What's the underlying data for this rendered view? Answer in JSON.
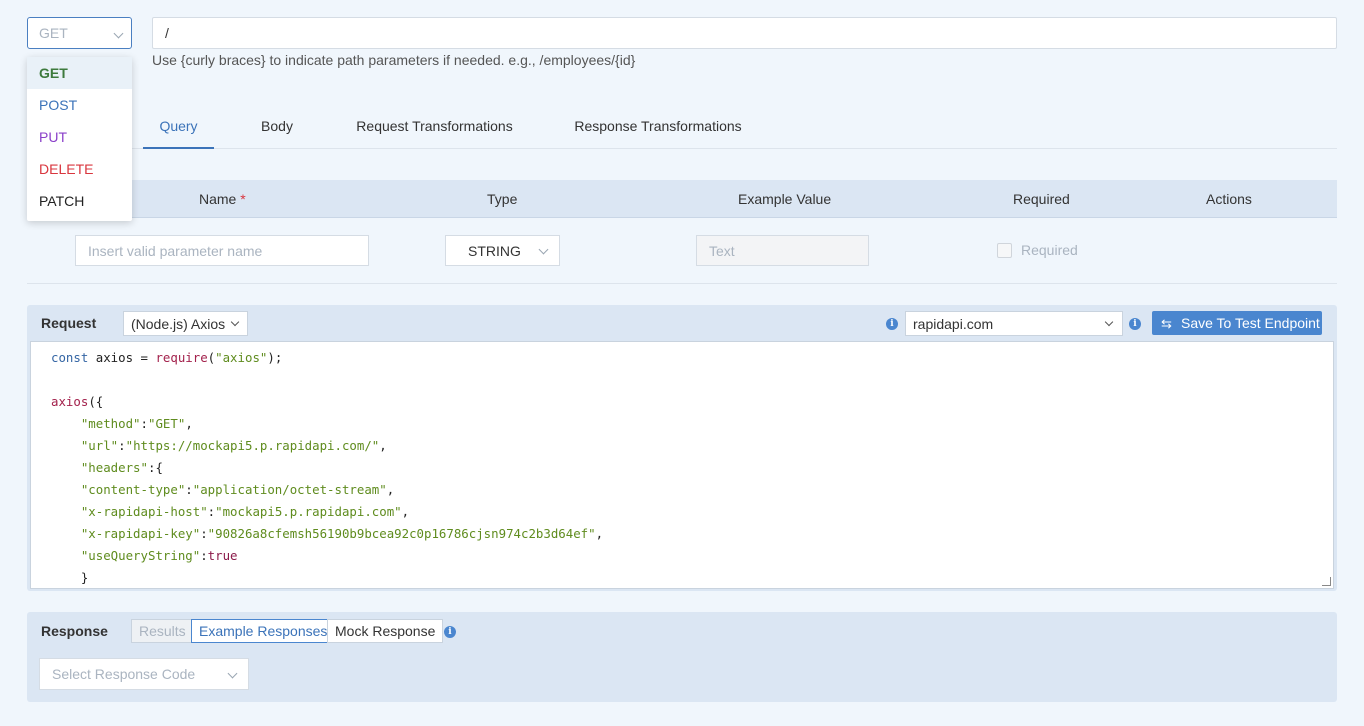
{
  "method": {
    "selected": "GET",
    "options": [
      {
        "label": "GET",
        "color": "#3d7a3d"
      },
      {
        "label": "POST",
        "color": "#3b73b9"
      },
      {
        "label": "PUT",
        "color": "#8a3fc9"
      },
      {
        "label": "DELETE",
        "color": "#d9363e"
      },
      {
        "label": "PATCH",
        "color": "#222222"
      }
    ]
  },
  "path": {
    "value": "/",
    "hint": "Use {curly braces} to indicate path parameters if needed. e.g., /employees/{id}"
  },
  "tabs": [
    "Query",
    "Body",
    "Request Transformations",
    "Response Transformations"
  ],
  "active_tab": "Query",
  "params": {
    "headers": {
      "name": "Name",
      "required_mark": "*",
      "type": "Type",
      "example": "Example Value",
      "required": "Required",
      "actions": "Actions"
    },
    "row": {
      "name_placeholder": "Insert valid parameter name",
      "type": "STRING",
      "example_placeholder": "Text",
      "required_label": "Required"
    }
  },
  "request": {
    "label": "Request",
    "language": "(Node.js) Axios",
    "host": "rapidapi.com",
    "save_button": "Save To Test Endpoint",
    "code": [
      [
        [
          "kw",
          "const "
        ],
        [
          "id",
          "axios "
        ],
        [
          "id",
          "= "
        ],
        [
          "fn",
          "require"
        ],
        [
          "id",
          "("
        ],
        [
          "str",
          "\"axios\""
        ],
        [
          "id",
          ");"
        ]
      ],
      [],
      [
        [
          "fn",
          "axios"
        ],
        [
          "id",
          "({"
        ]
      ],
      [
        [
          "id",
          "    "
        ],
        [
          "str",
          "\"method\""
        ],
        [
          "id",
          ":"
        ],
        [
          "str",
          "\"GET\""
        ],
        [
          "id",
          ","
        ]
      ],
      [
        [
          "id",
          "    "
        ],
        [
          "str",
          "\"url\""
        ],
        [
          "id",
          ":"
        ],
        [
          "str",
          "\"https://mockapi5.p.rapidapi.com/\""
        ],
        [
          "id",
          ","
        ]
      ],
      [
        [
          "id",
          "    "
        ],
        [
          "str",
          "\"headers\""
        ],
        [
          "id",
          ":{"
        ]
      ],
      [
        [
          "id",
          "    "
        ],
        [
          "str",
          "\"content-type\""
        ],
        [
          "id",
          ":"
        ],
        [
          "str",
          "\"application/octet-stream\""
        ],
        [
          "id",
          ","
        ]
      ],
      [
        [
          "id",
          "    "
        ],
        [
          "str",
          "\"x-rapidapi-host\""
        ],
        [
          "id",
          ":"
        ],
        [
          "str",
          "\"mockapi5.p.rapidapi.com\""
        ],
        [
          "id",
          ","
        ]
      ],
      [
        [
          "id",
          "    "
        ],
        [
          "str",
          "\"x-rapidapi-key\""
        ],
        [
          "id",
          ":"
        ],
        [
          "str",
          "\"90826a8cfemsh56190b9bcea92c0p16786cjsn974c2b3d64ef\""
        ],
        [
          "id",
          ","
        ]
      ],
      [
        [
          "id",
          "    "
        ],
        [
          "str",
          "\"useQueryString\""
        ],
        [
          "id",
          ":"
        ],
        [
          "lit",
          "true"
        ]
      ],
      [
        [
          "id",
          "    }"
        ]
      ]
    ]
  },
  "response": {
    "label": "Response",
    "tabs": [
      "Results",
      "Example Responses",
      "Mock Response"
    ],
    "code_placeholder": "Select Response Code"
  },
  "icons": [
    "chevron-down-icon",
    "info-icon",
    "swap-icon",
    "resize-grip-icon"
  ]
}
